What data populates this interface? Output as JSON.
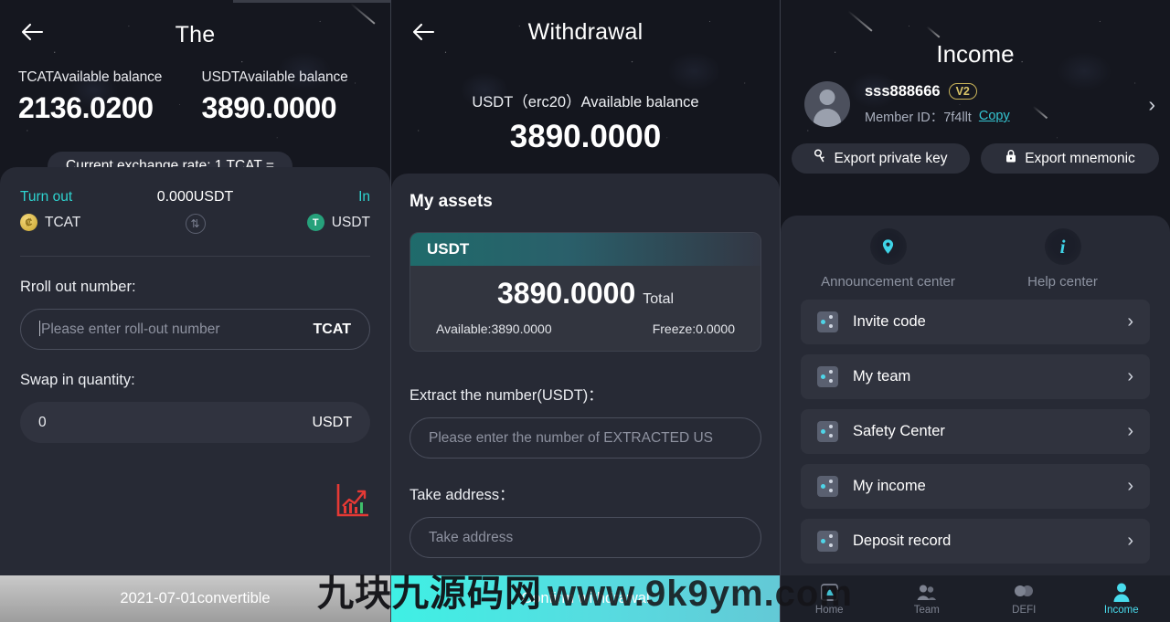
{
  "panel1": {
    "title": "The",
    "back_icon": "back-arrow-icon",
    "balances": [
      {
        "label": "TCATAvailable balance",
        "value": "2136.0200"
      },
      {
        "label": "USDTAvailable balance",
        "value": "3890.0000"
      }
    ],
    "rate_pill": "Current exchange rate: 1 TCAT =",
    "swap": {
      "out_label": "Turn out",
      "out_coin": "TCAT",
      "mid_amount": "0.000USDT",
      "swap_icon": "swap-circle-icon",
      "in_label": "In",
      "in_coin": "USDT"
    },
    "rollout": {
      "label": "Rroll out number:",
      "placeholder": "Please enter roll-out number",
      "suffix": "TCAT"
    },
    "swapin": {
      "label": "Swap in quantity:",
      "value": "0",
      "suffix": "USDT"
    },
    "chart_icon": "growth-chart-icon",
    "bottom_button": "2021-07-01convertible"
  },
  "panel2": {
    "title": "Withdrawal",
    "back_icon": "back-arrow-icon",
    "subtitle": "USDT（erc20）Available balance",
    "balance": "3890.0000",
    "section_title": "My assets",
    "asset": {
      "name": "USDT",
      "total_value": "3890.0000",
      "total_label": "Total",
      "available": "Available:3890.0000",
      "freeze": "Freeze:0.0000"
    },
    "extract": {
      "label": "Extract the number(USDT)：",
      "placeholder": "Please enter the number of EXTRACTED US"
    },
    "address": {
      "label": "Take address：",
      "placeholder": "Take address"
    },
    "confirm_button": "Confirm withdrawal"
  },
  "panel3": {
    "title": "Income",
    "avatar_icon": "user-avatar-icon",
    "user_name": "sss888666",
    "vip_badge": "V2",
    "member_label": "Member ID：7f4llt",
    "copy_link": "Copy",
    "chevron_icon": "chevron-right-icon",
    "export_buttons": [
      {
        "label": "Export private key",
        "icon": "key-icon"
      },
      {
        "label": "Export mnemonic",
        "icon": "lock-icon"
      }
    ],
    "quick_links": [
      {
        "label": "Announcement center",
        "icon": "location-pin-icon"
      },
      {
        "label": "Help center",
        "icon": "info-icon"
      }
    ],
    "menu_items": [
      {
        "label": "Invite code",
        "icon": "share-nodes-icon"
      },
      {
        "label": "My team",
        "icon": "share-nodes-icon"
      },
      {
        "label": "Safety Center",
        "icon": "share-nodes-icon"
      },
      {
        "label": "My income",
        "icon": "share-nodes-icon"
      },
      {
        "label": "Deposit record",
        "icon": "share-nodes-icon"
      }
    ],
    "tabs": [
      {
        "label": "Home",
        "icon": "home-icon",
        "active": false
      },
      {
        "label": "Team",
        "icon": "team-icon",
        "active": false
      },
      {
        "label": "DEFI",
        "icon": "defi-icon",
        "active": false
      },
      {
        "label": "Income",
        "icon": "income-person-icon",
        "active": true
      }
    ]
  },
  "watermark": {
    "cn": "九块九源码网",
    "en": "www.9k9ym.com"
  },
  "colors": {
    "accent_cyan": "#3fd3e6",
    "teal": "#2ed3cf",
    "gold": "#d9c468",
    "usdt_green": "#26a17b",
    "red_chart": "#e53935"
  }
}
